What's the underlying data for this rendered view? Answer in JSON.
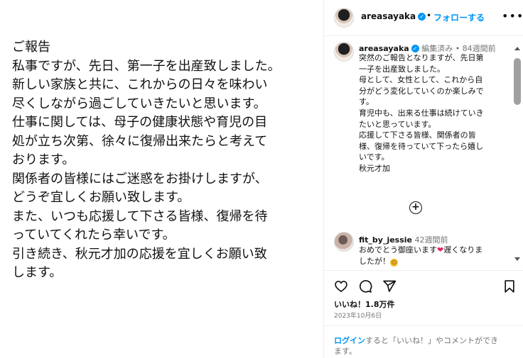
{
  "post_image": {
    "lines": [
      "ご報告",
      "",
      "私事ですが、先日、第一子を出産致しました。",
      "新しい家族と共に、これからの日々を味わい",
      "尽くしながら過ごしていきたいと思います。",
      "仕事に関しては、母子の健康状態や育児の目",
      "処が立ち次第、徐々に復帰出来たらと考えて",
      "おります。",
      "関係者の皆様にはご迷惑をお掛けしますが、",
      "どうぞ宜しくお願い致します。",
      "また、いつも応援して下さる皆様、復帰を待",
      "っていてくれたら幸いです。",
      "",
      "引き続き、秋元才加の応援を宜しくお願い致",
      "します。"
    ]
  },
  "header": {
    "username": "areasayaka",
    "dot": "•",
    "follow_label": "フォローする",
    "more_label": "•••"
  },
  "caption": {
    "username": "areasayaka",
    "meta": "編集済み • 84週間前",
    "lines": [
      "突然のご報告となりますが、先日第",
      "一子を出産致しました。",
      "母として、女性として、これから自",
      "分がどう変化していくのか楽しみで",
      "す。",
      "育児中も、出来る仕事は続けていき",
      "たいと思っています。",
      "応援して下さる皆様、関係者の皆",
      "様、復帰を待っていて下ったら嬉し",
      "いです。",
      "",
      "秋元才加"
    ]
  },
  "load_more_label": "+",
  "comment": {
    "username": "fit_by_jessie",
    "time": "42週間前",
    "line1": "おめでとう御座います",
    "line1_after": "遅くなりま",
    "line2": "したが！"
  },
  "likes": "いいね！1.8万件",
  "date": "2023年10月6日",
  "login_note": {
    "link": "ログイン",
    "rest": "すると「いいね！」やコメントができ",
    "rest2": "ます。"
  },
  "colors": {
    "accent": "#0095f6",
    "muted": "#737373",
    "heart": "#e0245e"
  },
  "icons": [
    "verified-icon",
    "heart-icon",
    "comment-icon",
    "share-icon",
    "bookmark-icon",
    "add-circle-icon",
    "more-icon"
  ]
}
